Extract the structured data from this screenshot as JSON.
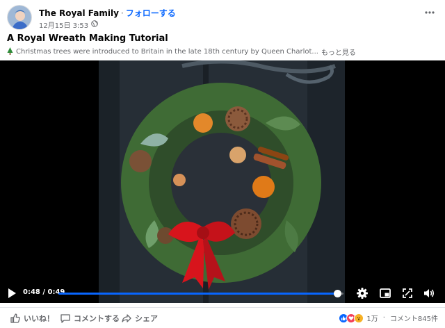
{
  "post": {
    "page_name": "The Royal Family",
    "separator": "·",
    "follow_label": "フォローする",
    "date": "12月15日 3:53",
    "privacy_icon": "globe-icon",
    "title": "A Royal Wreath Making Tutorial",
    "description": "Christmas trees were introduced to Britain in the late 18th century by Queen Charlot...",
    "see_more": "もっと見る"
  },
  "video": {
    "time": "0:48 / 0:49",
    "progress": 0.98
  },
  "actions": {
    "like_label": "いいね！",
    "comment_label": "コメントする",
    "share_label": "シェア"
  },
  "reactions": {
    "count": "1万",
    "comments": "コメント845件"
  },
  "colors": {
    "accent": "#0866ff",
    "secondary_text": "#65676b",
    "ribbon": "#d8141c"
  }
}
